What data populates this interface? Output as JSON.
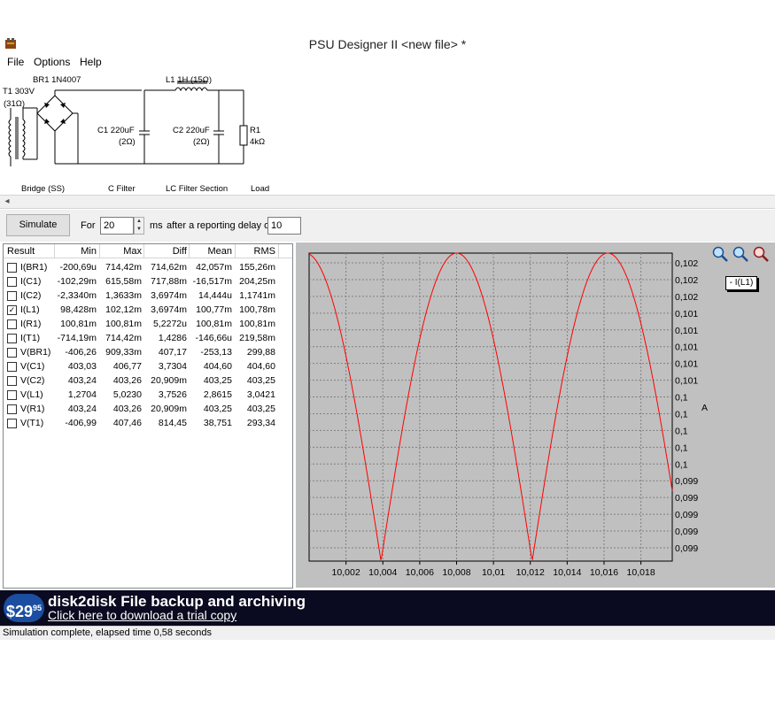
{
  "window": {
    "title": "PSU Designer II  <new file> *"
  },
  "menu": [
    "File",
    "Options",
    "Help"
  ],
  "schematic": {
    "bridge_part": "BR1 1N4007",
    "transformer": "T1 303V",
    "transformer_res": "(31Ω)",
    "inductor": "L1 1H (15Ω)",
    "c1": "C1 220uF",
    "c1_res": "(2Ω)",
    "c2": "C2 220uF",
    "c2_res": "(2Ω)",
    "r1": "R1",
    "r1_val": "4kΩ",
    "sections": [
      "Bridge (SS)",
      "C Filter",
      "LC Filter Section",
      "Load"
    ]
  },
  "controls": {
    "simulate": "Simulate",
    "for_label": "For",
    "duration": "20",
    "ms_label": "ms",
    "delay_label": "after a reporting delay of",
    "delay": "10"
  },
  "results": {
    "columns": [
      "Result",
      "Min",
      "Max",
      "Diff",
      "Mean",
      "RMS"
    ],
    "rows": [
      {
        "name": "I(BR1)",
        "checked": false,
        "min": "-200,69u",
        "max": "714,42m",
        "diff": "714,62m",
        "mean": "42,057m",
        "rms": "155,26m"
      },
      {
        "name": "I(C1)",
        "checked": false,
        "min": "-102,29m",
        "max": "615,58m",
        "diff": "717,88m",
        "mean": "-16,517m",
        "rms": "204,25m"
      },
      {
        "name": "I(C2)",
        "checked": false,
        "min": "-2,3340m",
        "max": "1,3633m",
        "diff": "3,6974m",
        "mean": "14,444u",
        "rms": "1,1741m"
      },
      {
        "name": "I(L1)",
        "checked": true,
        "min": "98,428m",
        "max": "102,12m",
        "diff": "3,6974m",
        "mean": "100,77m",
        "rms": "100,78m"
      },
      {
        "name": "I(R1)",
        "checked": false,
        "min": "100,81m",
        "max": "100,81m",
        "diff": "5,2272u",
        "mean": "100,81m",
        "rms": "100,81m"
      },
      {
        "name": "I(T1)",
        "checked": false,
        "min": "-714,19m",
        "max": "714,42m",
        "diff": "1,4286",
        "mean": "-146,66u",
        "rms": "219,58m"
      },
      {
        "name": "V(BR1)",
        "checked": false,
        "min": "-406,26",
        "max": "909,33m",
        "diff": "407,17",
        "mean": "-253,13",
        "rms": "299,88"
      },
      {
        "name": "V(C1)",
        "checked": false,
        "min": "403,03",
        "max": "406,77",
        "diff": "3,7304",
        "mean": "404,60",
        "rms": "404,60"
      },
      {
        "name": "V(C2)",
        "checked": false,
        "min": "403,24",
        "max": "403,26",
        "diff": "20,909m",
        "mean": "403,25",
        "rms": "403,25"
      },
      {
        "name": "V(L1)",
        "checked": false,
        "min": "1,2704",
        "max": "5,0230",
        "diff": "3,7526",
        "mean": "2,8615",
        "rms": "3,0421"
      },
      {
        "name": "V(R1)",
        "checked": false,
        "min": "403,24",
        "max": "403,26",
        "diff": "20,909m",
        "mean": "403,25",
        "rms": "403,25"
      },
      {
        "name": "V(T1)",
        "checked": false,
        "min": "-406,99",
        "max": "407,46",
        "diff": "814,45",
        "mean": "38,751",
        "rms": "293,34"
      }
    ]
  },
  "plot": {
    "legend": "- I(L1)",
    "y_axis_symbol": "A",
    "zoom_icons": [
      "zoom-in-icon",
      "zoom-fit-icon",
      "zoom-out-icon"
    ]
  },
  "chart_data": {
    "type": "line",
    "series": [
      {
        "name": "I(L1)",
        "color": "#ff0000"
      }
    ],
    "x_ticks": [
      "10,002",
      "10,004",
      "10,006",
      "10,008",
      "10,01",
      "10,012",
      "10,014",
      "10,016",
      "10,018"
    ],
    "y_ticks": [
      "0,102",
      "0,102",
      "0,102",
      "0,101",
      "0,101",
      "0,101",
      "0,101",
      "0,101",
      "0,1",
      "0,1",
      "0,1",
      "0,1",
      "0,1",
      "0,099",
      "0,099",
      "0,099",
      "0,099",
      "0,099"
    ],
    "x_range": [
      10.0,
      10.0197
    ],
    "y_range": [
      0.09842,
      0.10212
    ],
    "waveform": {
      "peaks_x": [
        10.008,
        10.0161
      ],
      "troughs_x": [
        10.0039,
        10.0121
      ],
      "start_x": 10.0,
      "end_x": 10.0197
    },
    "grid": true
  },
  "banner": {
    "price": "$29",
    "price_cents": "95",
    "title": "disk2disk File backup and archiving",
    "link": "Click here to download a trial copy"
  },
  "status": "Simulation complete, elapsed time 0,58 seconds"
}
